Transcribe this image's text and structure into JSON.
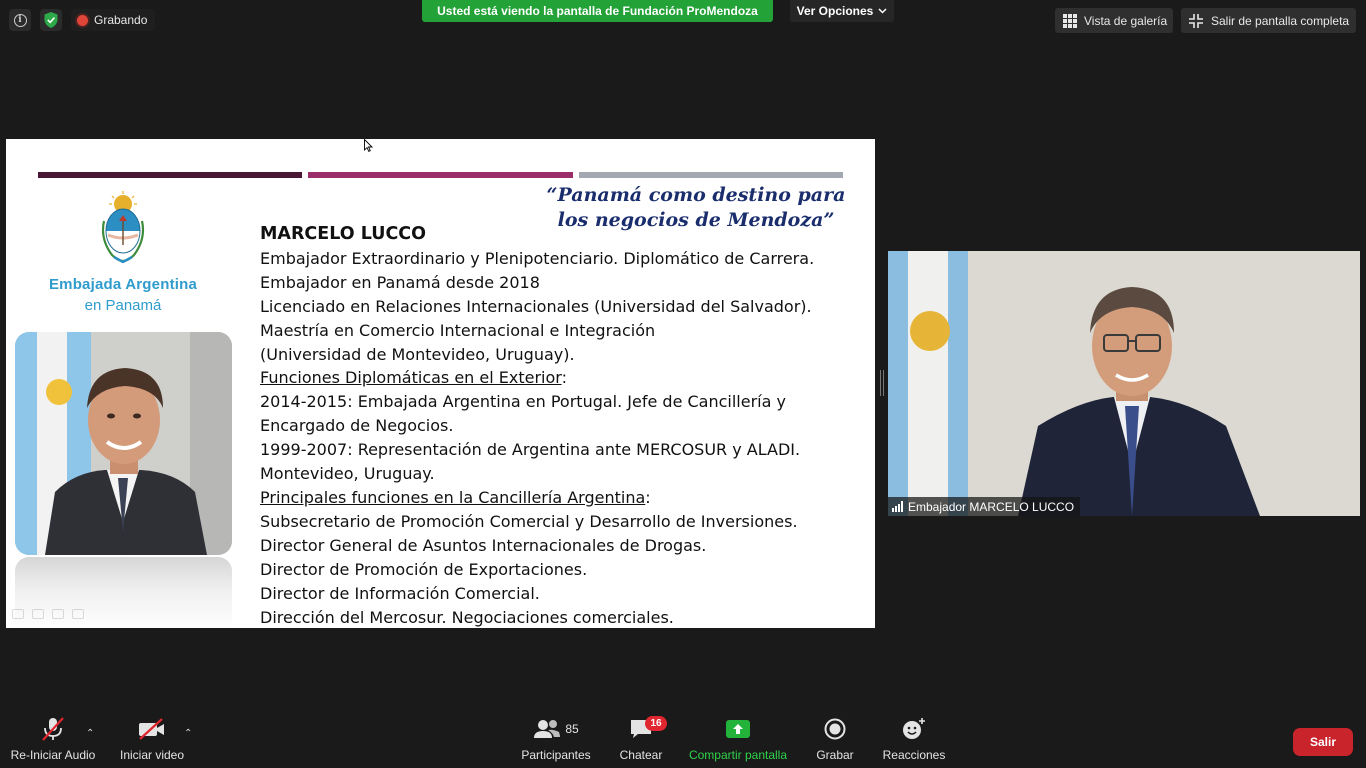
{
  "topbar": {
    "recording_label": "Grabando",
    "share_banner": "Usted está viendo la pantalla de Fundación ProMendoza",
    "view_options_label": "Ver Opciones",
    "gallery_view_label": "Vista de galería",
    "exit_fullscreen_label": "Salir de pantalla completa"
  },
  "slide": {
    "quote_line1": "“Panamá como destino para",
    "quote_line2": "los negocios de Mendoza”",
    "embassy_name": "Embajada Argentina",
    "embassy_location": "en Panamá",
    "bio_name": "MARCELO LUCCO",
    "bio_lines": [
      "Embajador Extraordinario y Plenipotenciario. Diplomático de Carrera.",
      "Embajador en Panamá desde 2018",
      "Licenciado en Relaciones Internacionales (Universidad del Salvador).",
      "Maestría en Comercio Internacional e Integración",
      "(Universidad de Montevideo, Uruguay)."
    ],
    "section1_heading": "Funciones Diplomáticas en el Exterior",
    "section1_lines": [
      "2014-2015: Embajada Argentina en Portugal. Jefe de Cancillería y",
      "Encargado de Negocios.",
      "1999-2007: Representación de Argentina ante MERCOSUR y ALADI.",
      "Montevideo, Uruguay."
    ],
    "section2_heading": "Principales funciones en la Cancillería Argentina",
    "section2_lines": [
      "Subsecretario de Promoción Comercial y Desarrollo de Inversiones.",
      "Director General de Asuntos Internacionales de Drogas.",
      "Director de Promoción de Exportaciones.",
      "Director de Información Comercial.",
      "Dirección del Mercosur. Negociaciones comerciales."
    ],
    "heading_suffix": ":"
  },
  "video": {
    "participant_name": "Embajador MARCELO LUCCO"
  },
  "toolbar": {
    "audio_label": "Re-Iniciar Audio",
    "video_label": "Iniciar video",
    "participants_label": "Participantes",
    "participants_count": "85",
    "chat_label": "Chatear",
    "chat_badge": "16",
    "share_label": "Compartir pantalla",
    "record_label": "Grabar",
    "reactions_label": "Reacciones",
    "leave_label": "Salir"
  },
  "colors": {
    "share_green": "#23a237",
    "leave_red": "#c9232b",
    "quote_navy": "#1a2d6d",
    "embassy_blue": "#2f9ccd",
    "bar_dark": "#4a1636",
    "bar_magenta": "#9c2d6b",
    "bar_grey": "#a3a8b2"
  },
  "icons": [
    "info-icon",
    "shield-check-icon",
    "record-dot-icon",
    "chevron-down-icon",
    "grid-icon",
    "exit-fullscreen-icon",
    "mic-muted-icon",
    "camera-off-icon",
    "participants-icon",
    "chat-icon",
    "share-screen-icon",
    "record-icon",
    "reactions-icon",
    "signal-bars-icon"
  ]
}
